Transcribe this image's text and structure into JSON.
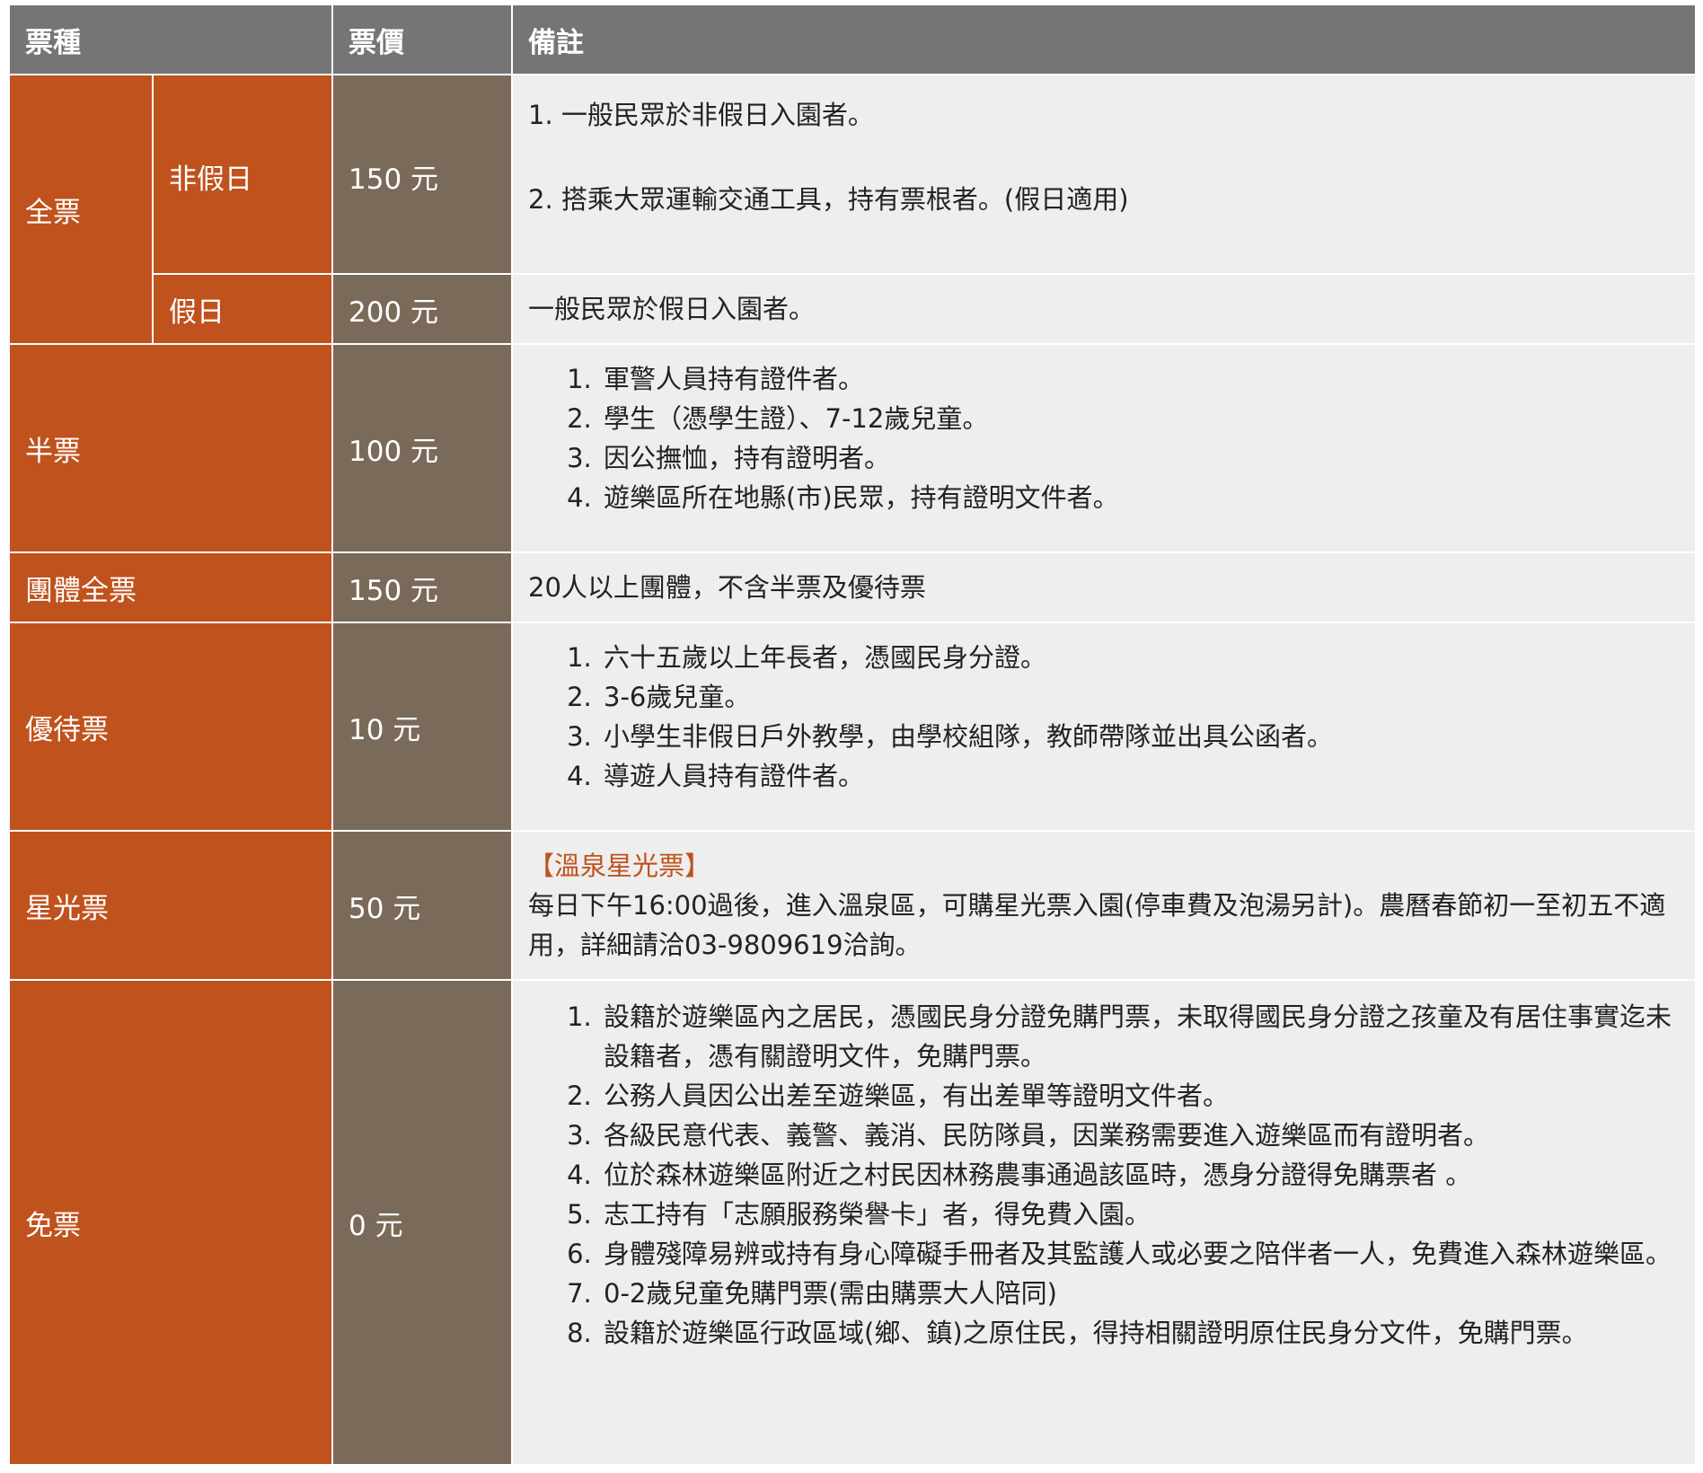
{
  "header": {
    "type": "票種",
    "price": "票價",
    "note": "備註"
  },
  "full": {
    "label": "全票",
    "weekday": {
      "label": "非假日",
      "price": "150 元",
      "notes": [
        "1. 一般民眾於非假日入園者。",
        "2. 搭乘大眾運輸交通工具，持有票根者。(假日適用)"
      ]
    },
    "holiday": {
      "label": "假日",
      "price": "200 元",
      "note": "一般民眾於假日入園者。"
    }
  },
  "half": {
    "label": "半票",
    "price": "100 元",
    "notes": [
      "軍警人員持有證件者。",
      "學生（憑學生證）、7-12歲兒童。",
      "因公撫恤，持有證明者。",
      "遊樂區所在地縣(市)民眾，持有證明文件者。"
    ]
  },
  "group": {
    "label": "團體全票",
    "price": "150 元",
    "note": "20人以上團體，不含半票及優待票"
  },
  "concession": {
    "label": "優待票",
    "price": "10 元",
    "notes": [
      "六十五歲以上年長者，憑國民身分證。",
      "3-6歲兒童。",
      "小學生非假日戶外教學，由學校組隊，教師帶隊並出具公函者。",
      "導遊人員持有證件者。"
    ]
  },
  "starlight": {
    "label": "星光票",
    "price": "50 元",
    "highlight": "【溫泉星光票】",
    "note": "每日下午16:00過後，進入溫泉區，可購星光票入園(停車費及泡湯另計)。農曆春節初一至初五不適用，詳細請洽03-9809619洽詢。"
  },
  "free": {
    "label": "免票",
    "price": "0 元",
    "notes": [
      "設籍於遊樂區內之居民，憑國民身分證免購門票，未取得國民身分證之孩童及有居住事實迄未設籍者，憑有關證明文件，免購門票。",
      "公務人員因公出差至遊樂區，有出差單等證明文件者。",
      "各級民意代表、義警、義消、民防隊員，因業務需要進入遊樂區而有證明者。",
      "位於森林遊樂區附近之村民因林務農事通過該區時，憑身分證得免購票者 。",
      "志工持有「志願服務榮譽卡」者，得免費入園。",
      "身體殘障易辨或持有身心障礙手冊者及其監護人或必要之陪伴者一人，免費進入森林遊樂區。",
      "0-2歲兒童免購門票(需由購票大人陪同)",
      "設籍於遊樂區行政區域(鄉、鎮)之原住民，得持相關證明原住民身分文件，免購門票。"
    ]
  }
}
